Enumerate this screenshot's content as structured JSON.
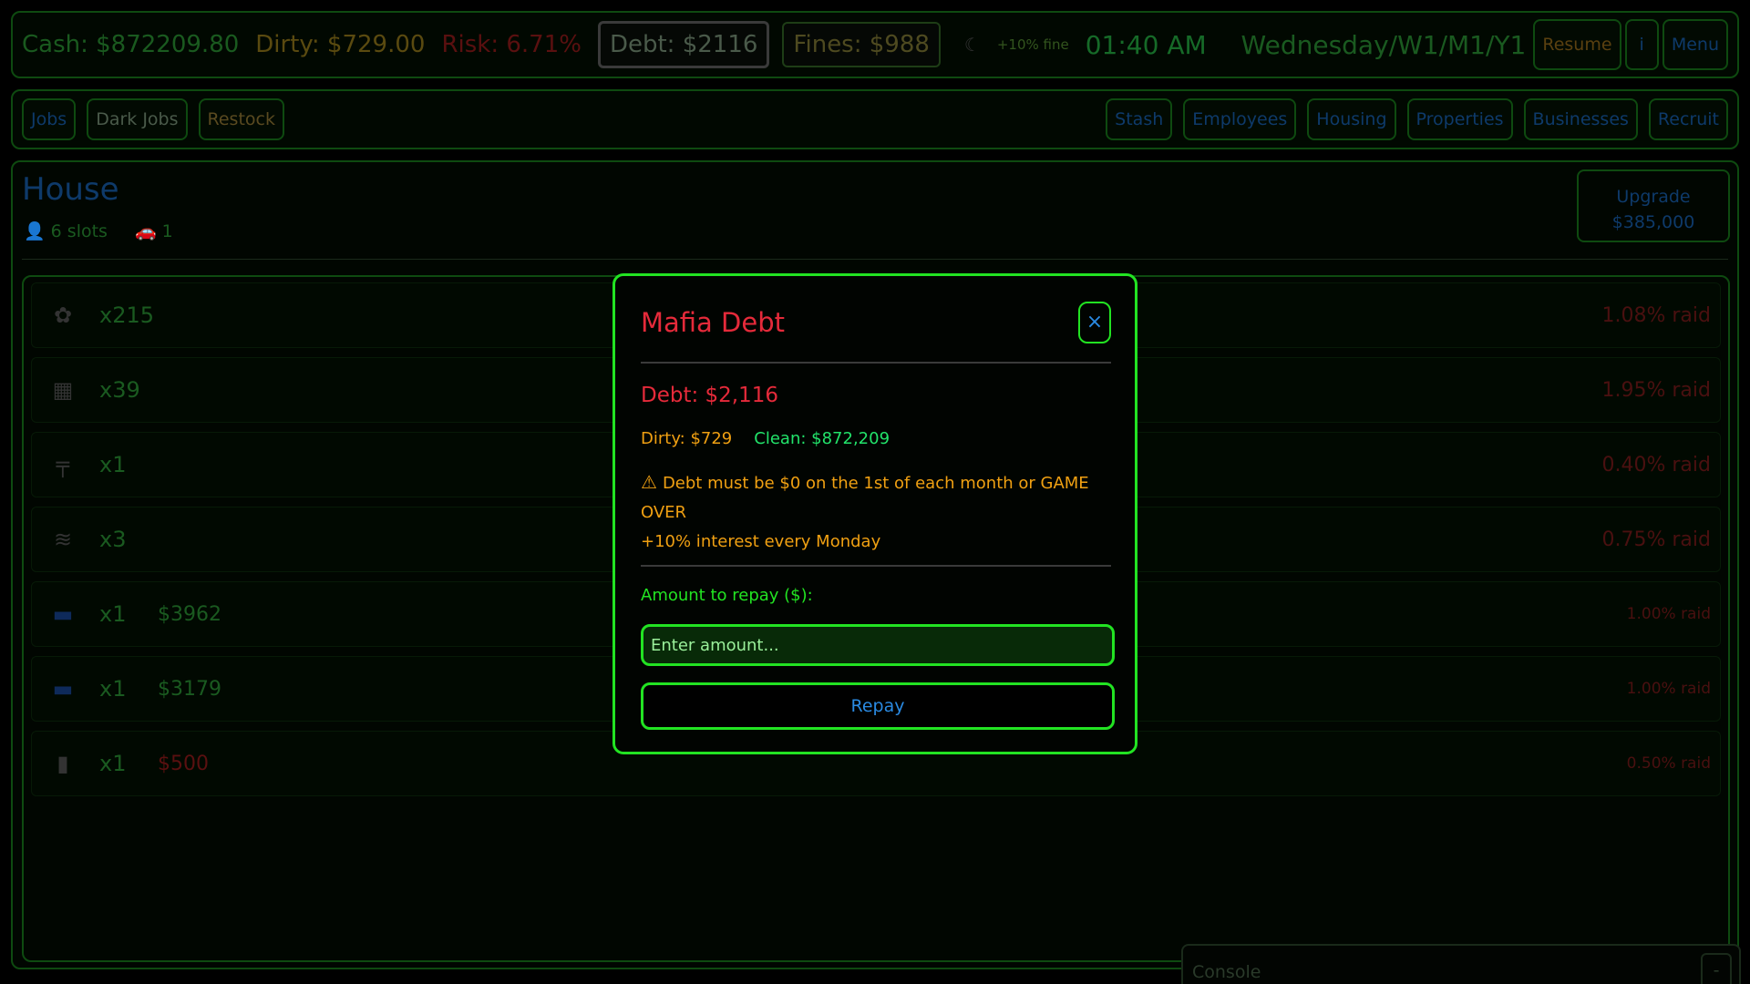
{
  "topbar": {
    "cash": "Cash: $872209.80",
    "dirty": "Dirty: $729.00",
    "risk": "Risk: 6.71%",
    "debt": "Debt: $2116",
    "fines": "Fines: $988",
    "fine_note": "+10% fine",
    "time": "01:40 AM",
    "date": "Wednesday/W1/M1/Y1",
    "resume": "Resume",
    "info": "i",
    "menu": "Menu"
  },
  "nav": {
    "left": [
      "Jobs",
      "Dark Jobs",
      "Restock"
    ],
    "right": [
      "Stash",
      "Employees",
      "Housing",
      "Properties",
      "Businesses",
      "Recruit"
    ]
  },
  "house": {
    "title": "House",
    "slots": "6 slots",
    "vehicles": "1",
    "upgrade_label": "Upgrade",
    "upgrade_price": "$385,000"
  },
  "stash_items": [
    {
      "icon": "weed-icon",
      "qty": "x215",
      "price": "",
      "raid": "1.08% raid"
    },
    {
      "icon": "bag-icon",
      "qty": "x39",
      "price": "",
      "raid": "1.95% raid"
    },
    {
      "icon": "pistol-icon",
      "qty": "x1",
      "price": "",
      "raid": "0.40% raid"
    },
    {
      "icon": "cash-stack-icon",
      "qty": "x3",
      "price": "",
      "raid": "0.75% raid"
    },
    {
      "icon": "card-icon",
      "qty": "x1",
      "price": "$3962",
      "raid": "1.00% raid"
    },
    {
      "icon": "card-icon",
      "qty": "x1",
      "price": "$3179",
      "raid": "1.00% raid"
    },
    {
      "icon": "bottle-icon",
      "qty": "x1",
      "price": "$500",
      "raid": "0.50% raid"
    }
  ],
  "console": {
    "title": "Console",
    "min": "-"
  },
  "modal": {
    "title": "Mafia Debt",
    "close": "×",
    "debt": "Debt: $2,116",
    "dirty": "Dirty: $729",
    "clean": "Clean: $872,209",
    "warning": "Debt must be $0 on the 1st of each month or GAME OVER",
    "interest": "+10% interest every Monday",
    "amount_label": "Amount to repay ($):",
    "amount_value": "",
    "amount_placeholder": "Enter amount...",
    "repay": "Repay"
  },
  "colors": {
    "accent_green": "#22e322",
    "debt_red": "#e52a3a",
    "warn_orange": "#f0a012",
    "link_blue": "#2a8ae2"
  }
}
